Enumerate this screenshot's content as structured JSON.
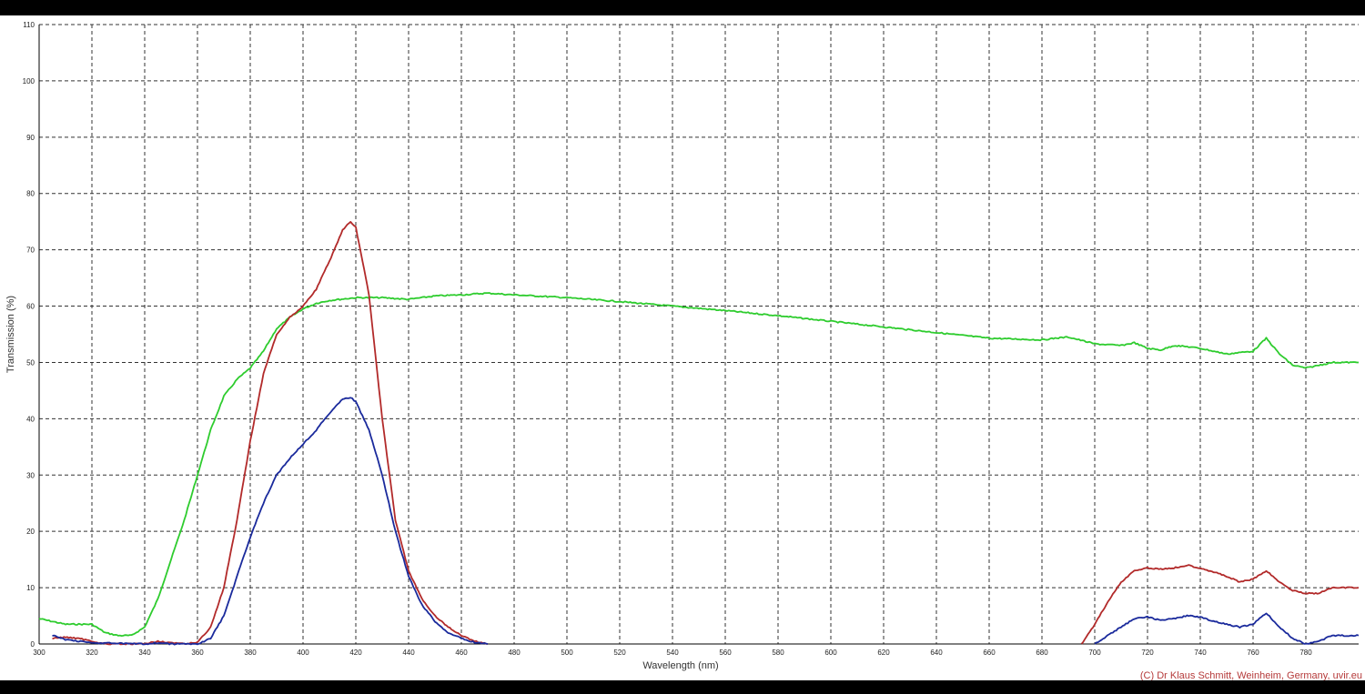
{
  "chart_data": {
    "type": "line",
    "xlabel": "Wavelength (nm)",
    "ylabel": "Transmission (%)",
    "xlim": [
      300,
      800
    ],
    "ylim": [
      0,
      110
    ],
    "x_ticks": [
      300,
      320,
      340,
      360,
      380,
      400,
      420,
      440,
      460,
      480,
      500,
      520,
      540,
      560,
      580,
      600,
      620,
      640,
      660,
      680,
      700,
      720,
      740,
      760,
      780
    ],
    "y_ticks": [
      0,
      10,
      20,
      30,
      40,
      50,
      60,
      70,
      80,
      90,
      100,
      110
    ],
    "grid": true,
    "credit": "(C) Dr Klaus Schmitt, Weinheim, Germany, uvir.eu",
    "spectrum_bar_colors": [
      "#a090a8",
      "#4b0082",
      "#0000ff",
      "#00ccff",
      "#00ff00",
      "#ffff00",
      "#ff8000",
      "#ff0000",
      "#8b0000",
      "#200000",
      "#e8a0a0"
    ],
    "series": [
      {
        "color": "#2ecc2e",
        "x": [
          300,
          305,
          310,
          315,
          320,
          325,
          330,
          335,
          340,
          345,
          350,
          355,
          360,
          365,
          370,
          375,
          380,
          385,
          390,
          395,
          400,
          405,
          410,
          420,
          430,
          440,
          450,
          460,
          470,
          480,
          500,
          520,
          540,
          560,
          580,
          600,
          620,
          640,
          660,
          680,
          685,
          690,
          700,
          710,
          715,
          720,
          725,
          730,
          735,
          740,
          750,
          760,
          765,
          770,
          775,
          780,
          785,
          790,
          795,
          800
        ],
        "y": [
          4.5,
          4,
          3.5,
          3.5,
          3.5,
          2,
          1.5,
          1.5,
          3,
          8,
          15,
          22,
          30,
          38,
          44,
          47,
          49,
          52,
          56,
          58,
          59.5,
          60.5,
          61,
          61.5,
          61.5,
          61.2,
          61.8,
          62,
          62.3,
          62,
          61.5,
          60.8,
          60,
          59.2,
          58.3,
          57.3,
          56.3,
          55.3,
          54.3,
          54,
          54.3,
          54.5,
          53.3,
          53,
          53.5,
          52.5,
          52.2,
          53,
          52.8,
          52.5,
          51.5,
          52,
          54.3,
          51.5,
          49.5,
          49,
          49.5,
          50,
          50,
          50
        ]
      },
      {
        "color": "#b22a2a",
        "x": [
          305,
          310,
          315,
          320,
          325,
          340,
          345,
          350,
          355,
          360,
          365,
          370,
          375,
          380,
          385,
          390,
          395,
          400,
          405,
          410,
          415,
          418,
          420,
          425,
          430,
          435,
          440,
          445,
          450,
          455,
          460,
          465,
          470,
          695,
          700,
          705,
          710,
          715,
          720,
          725,
          730,
          735,
          740,
          745,
          750,
          755,
          760,
          765,
          770,
          775,
          780,
          785,
          790,
          795,
          800
        ],
        "y": [
          1,
          1.2,
          1,
          0.5,
          0,
          0,
          0.5,
          0.2,
          0,
          0.3,
          3,
          10,
          22,
          36,
          48,
          55,
          58,
          60,
          63,
          68,
          73.5,
          75,
          74,
          62,
          40,
          22,
          13,
          8,
          5,
          3,
          1.5,
          0.5,
          0,
          0,
          3.5,
          7.5,
          11,
          13,
          13.5,
          13.3,
          13.5,
          14,
          13.5,
          12.8,
          12,
          11,
          11.5,
          13,
          11,
          9.5,
          9,
          9,
          10,
          10,
          10
        ]
      },
      {
        "color": "#1a2a9c",
        "x": [
          305,
          310,
          315,
          320,
          340,
          345,
          350,
          355,
          360,
          365,
          370,
          375,
          380,
          385,
          390,
          395,
          400,
          405,
          410,
          415,
          418,
          420,
          425,
          430,
          435,
          440,
          445,
          450,
          455,
          460,
          465,
          470,
          700,
          705,
          710,
          715,
          720,
          725,
          730,
          735,
          740,
          745,
          750,
          755,
          760,
          765,
          770,
          775,
          780,
          785,
          790,
          795,
          800
        ],
        "y": [
          1.5,
          0.8,
          0.5,
          0.2,
          0,
          0.2,
          0,
          0,
          0,
          1,
          5,
          12,
          19,
          25,
          30,
          33,
          35.5,
          38,
          41,
          43.5,
          43.8,
          43,
          38,
          30,
          20,
          12,
          7,
          4,
          2,
          1,
          0.3,
          0,
          0,
          1.5,
          3,
          4.5,
          4.8,
          4.2,
          4.5,
          5,
          4.8,
          4,
          3.5,
          3,
          3.5,
          5.5,
          3,
          1,
          0,
          0.5,
          1.5,
          1.5,
          1.5
        ]
      }
    ]
  }
}
